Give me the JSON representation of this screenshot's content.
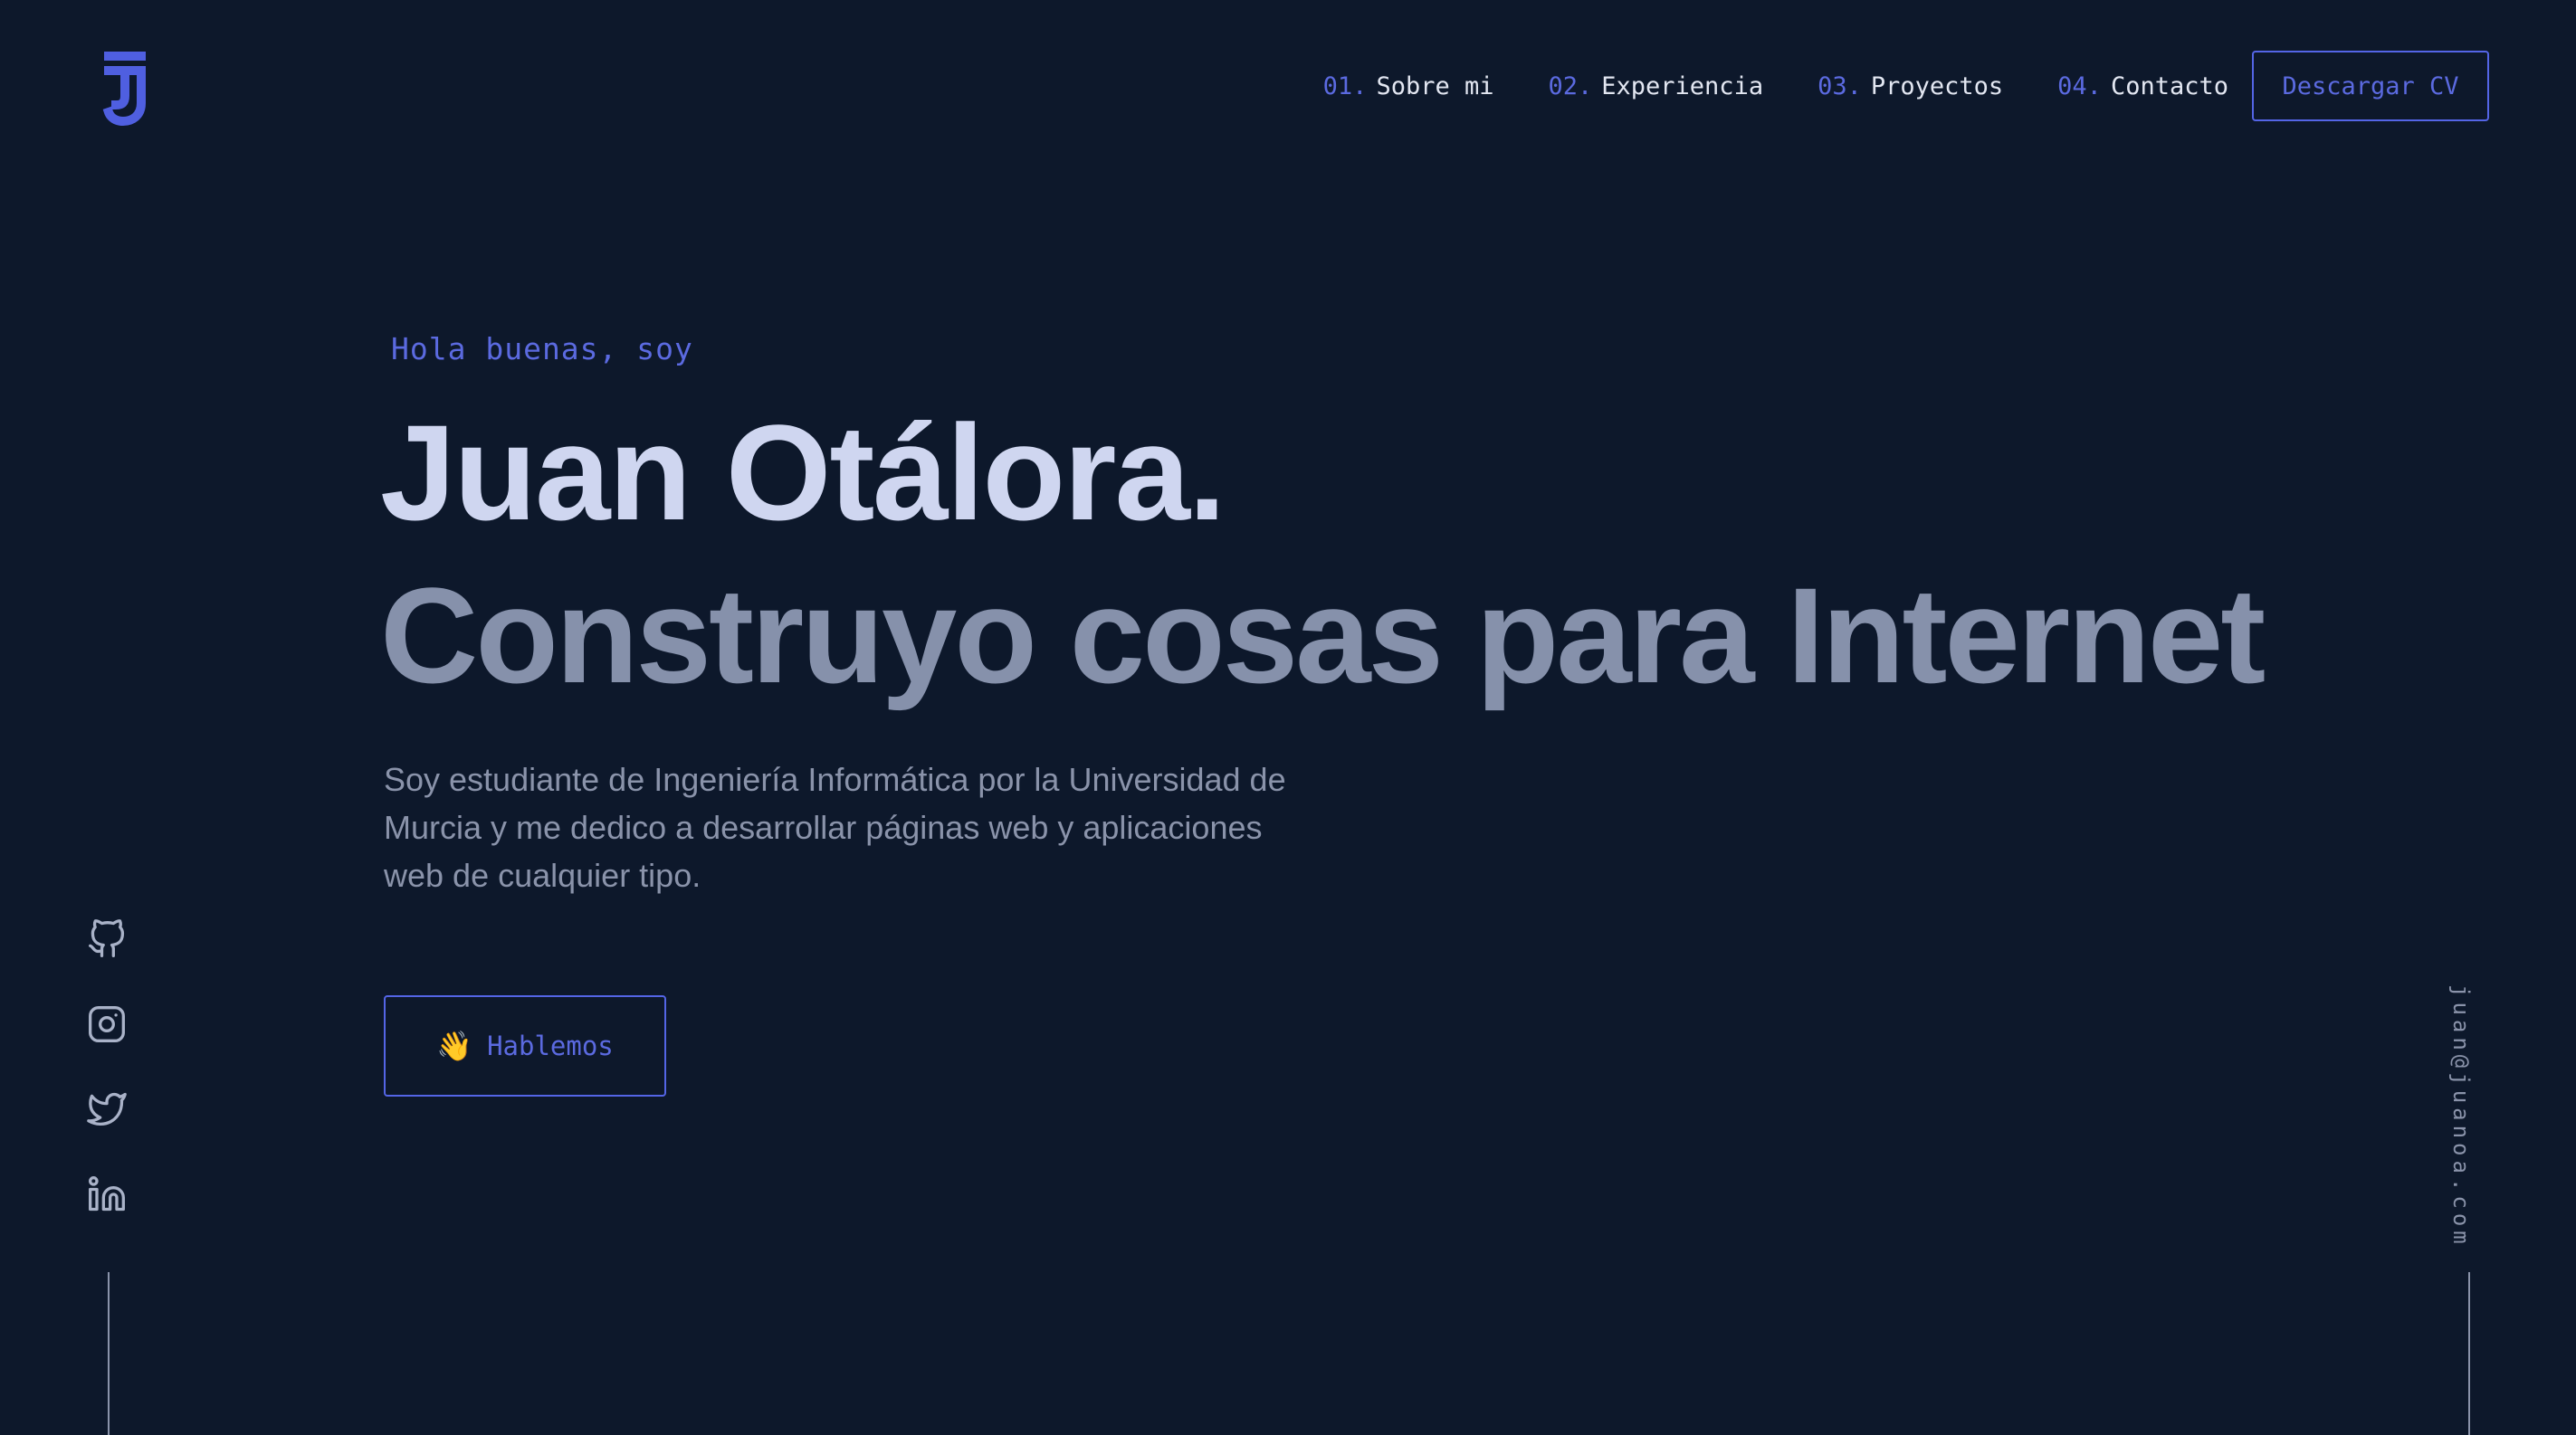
{
  "header": {
    "logo_icon": "jj-monogram-logo",
    "nav": [
      {
        "num": "01.",
        "label": "Sobre mi"
      },
      {
        "num": "02.",
        "label": "Experiencia"
      },
      {
        "num": "03.",
        "label": "Proyectos"
      },
      {
        "num": "04.",
        "label": "Contacto"
      }
    ],
    "cv_button": "Descargar CV"
  },
  "hero": {
    "greeting": "Hola buenas, soy",
    "name": "Juan Otálora.",
    "tagline": "Construyo cosas para Internet",
    "description": "Soy estudiante de Ingeniería Informática por la Universidad de Murcia y me dedico a desarrollar páginas web y aplicaciones web de cualquier tipo.",
    "cta": {
      "emoji": "👋",
      "label": "Hablemos"
    }
  },
  "social": {
    "icons": [
      "github-icon",
      "instagram-icon",
      "twitter-icon",
      "linkedin-icon"
    ]
  },
  "email": "juan@juanoa.com",
  "colors": {
    "background": "#0d182b",
    "accent": "#5b6ae0",
    "heading": "#cfd6f0",
    "subheading": "#8691ab",
    "text": "#8a93aa"
  }
}
